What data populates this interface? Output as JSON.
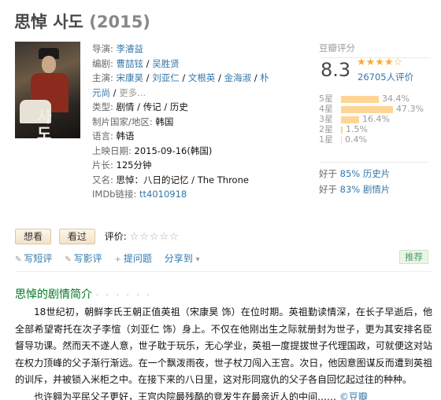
{
  "title": {
    "name": "思悼 사도",
    "year": "(2015)"
  },
  "info": {
    "director_label": "导演:",
    "director": "李濬益",
    "writer_label": "编剧:",
    "writers": [
      "曹喆铉",
      "吴胜贤"
    ],
    "cast_label": "主演:",
    "cast_line1": [
      "宋康昊",
      "刘亚仁",
      "文根英",
      "金海淑",
      "朴"
    ],
    "cast_line2": "元尚",
    "cast_more": "更多...",
    "genre_label": "类型:",
    "genre": "剧情 / 传记 / 历史",
    "country_label": "制片国家/地区:",
    "country": "韩国",
    "language_label": "语言:",
    "language": "韩语",
    "release_label": "上映日期:",
    "release": "2015-09-16(韩国)",
    "runtime_label": "片长:",
    "runtime": "125分钟",
    "aka_label": "又名:",
    "aka": "思悼：八日的记忆 / The Throne",
    "imdb_label": "IMDb链接:",
    "imdb": "tt4010918"
  },
  "rating": {
    "header": "豆瓣评分",
    "score": "8.3",
    "stars": "★★★★☆",
    "votes": "26705人评价",
    "breakdown": [
      {
        "label": "5星",
        "percent": "34.4%",
        "fraction": 0.344
      },
      {
        "label": "4星",
        "percent": "47.3%",
        "fraction": 0.473
      },
      {
        "label": "3星",
        "percent": "16.4%",
        "fraction": 0.164
      },
      {
        "label": "2星",
        "percent": "1.5%",
        "fraction": 0.015
      },
      {
        "label": "1星",
        "percent": "0.4%",
        "fraction": 0.004
      }
    ],
    "better1_prefix": "好于",
    "better1_link": "85% 历史片",
    "better2_prefix": "好于",
    "better2_link": "83% 剧情片"
  },
  "actions": {
    "want": "想看",
    "seen": "看过",
    "rate_label": "评价:",
    "empty_stars": "☆☆☆☆☆"
  },
  "tools": {
    "short_review": "写短评",
    "review": "写影评",
    "question": "提问题",
    "share": "分享到",
    "recommend": "推荐"
  },
  "intro": {
    "heading": "思悼的剧情简介",
    "dots": "· · · · · ·",
    "para1": "18世纪初，朝鲜李氏王朝正值英祖（宋康昊 饰）在位时期。英祖勤读情深，在长子早逝后，他全部希望寄托在次子李愃（刘亚仁 饰）身上。不仅在他刚出生之际就册封为世子，更为其安排名臣督导功课。然而天不遂人意，世子耽于玩乐，无心学业，英祖一度提拔世子代理国政，可就便这对站在权力顶峰的父子渐行渐远。在一个飘泼雨夜，世子杖刀闯入王宫。次日，他因意图谋反而遭到英祖的训斥，并被锁入米柜之中。在接下来的八日里，这对形同寇仇的父子各自回忆起过往的种种。",
    "para2": "也许翱为平民父子更好，王宫内院最残酷的竞发生在最亲近人的中间……",
    "source": "©豆瓣"
  }
}
